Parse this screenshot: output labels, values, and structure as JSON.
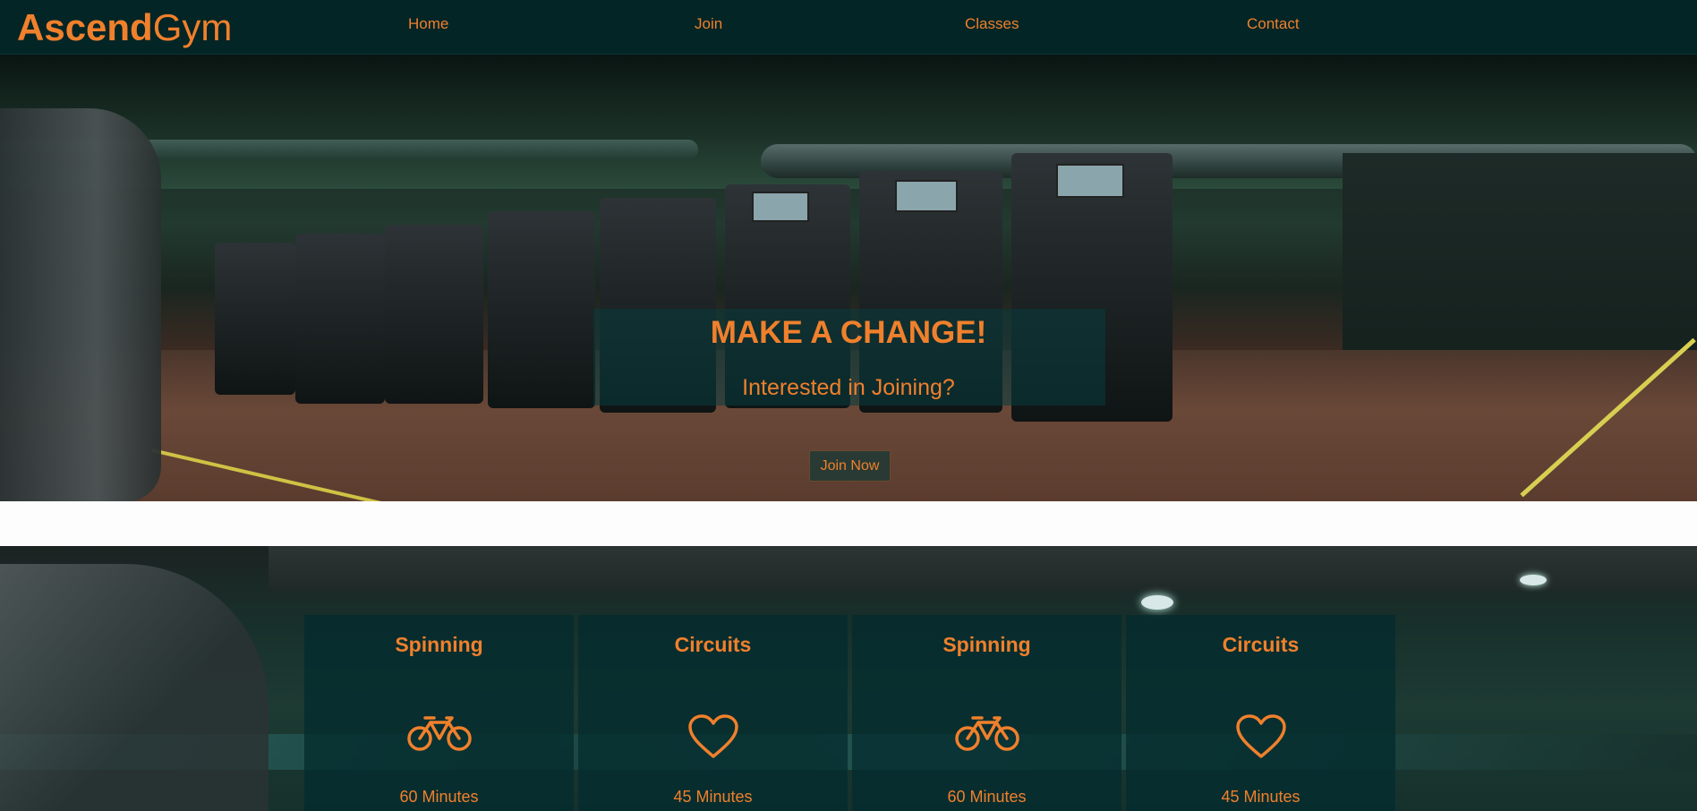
{
  "brand": {
    "name_bold": "Ascend",
    "name_light": "Gym",
    "accent_color": "#f0802c",
    "nav_bg_color": "#032526"
  },
  "nav": {
    "items": [
      {
        "label": "Home"
      },
      {
        "label": "Join"
      },
      {
        "label": "Classes"
      },
      {
        "label": "Contact"
      }
    ]
  },
  "hero": {
    "title": "MAKE A CHANGE!",
    "subtitle": "Interested in Joining?",
    "cta_label": "Join Now"
  },
  "classes": {
    "items": [
      {
        "title": "Spinning",
        "icon": "bicycle-icon",
        "duration": "60 Minutes"
      },
      {
        "title": "Circuits",
        "icon": "heart-icon",
        "duration": "45 Minutes"
      },
      {
        "title": "Spinning",
        "icon": "bicycle-icon",
        "duration": "60 Minutes"
      },
      {
        "title": "Circuits",
        "icon": "heart-icon",
        "duration": "45 Minutes"
      }
    ]
  }
}
